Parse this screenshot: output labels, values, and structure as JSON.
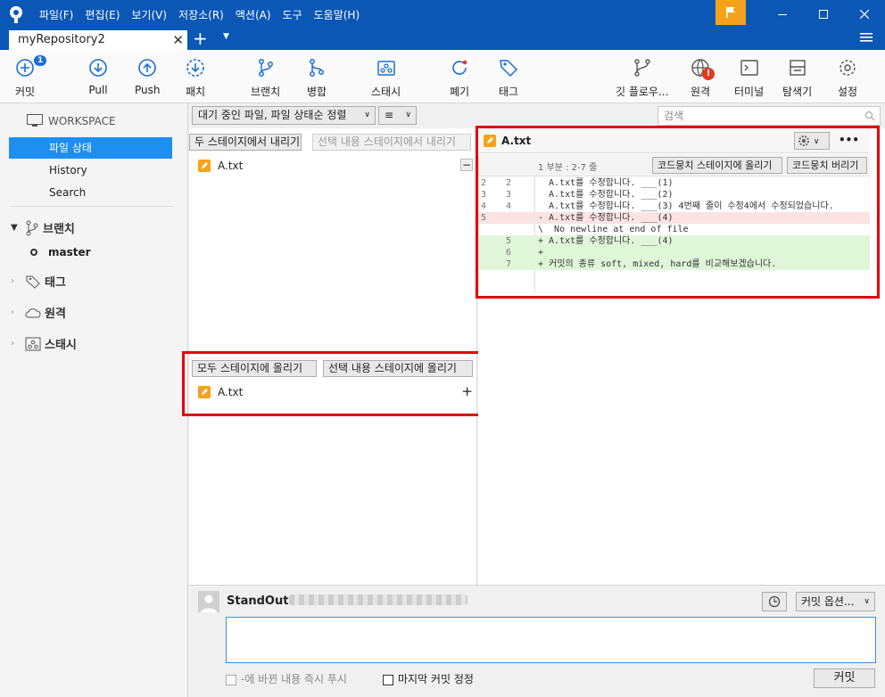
{
  "menu": [
    "파일(F)",
    "편집(E)",
    "보기(V)",
    "저장소(R)",
    "액션(A)",
    "도구",
    "도움말(H)"
  ],
  "tab": {
    "title": "myRepository2",
    "close": "✕",
    "new": "+"
  },
  "toolbar": {
    "commit": "커밋",
    "commit_badge": "1",
    "pull": "Pull",
    "push": "Push",
    "fetch": "패치",
    "branch": "브랜치",
    "merge": "병합",
    "stash": "스태시",
    "discard": "폐기",
    "tag": "태그",
    "gitflow": "깃 플로우...",
    "remote": "원격",
    "remote_badge": "!",
    "terminal": "터미널",
    "explorer": "탐색기",
    "settings": "설정"
  },
  "sidebar": {
    "workspace": "WORKSPACE",
    "items": [
      "파일 상태",
      "History",
      "Search"
    ],
    "branches": "브랜치",
    "master": "master",
    "tags": "태그",
    "remotes": "원격",
    "stashes": "스태시"
  },
  "filterbar": {
    "sort": "대기 중인 파일, 파일 상태순 정렬",
    "view": "≡",
    "search_placeholder": "검색"
  },
  "staged": {
    "unstage_all": "두 스테이지에서 내리기",
    "unstage_selected": "선택 내용 스테이지에서 내리기",
    "files": [
      {
        "name": "A.txt",
        "action": "−"
      }
    ]
  },
  "unstaged": {
    "stage_all": "모두 스테이지에 올리기",
    "stage_selected": "선택 내용 스테이지에 올리기",
    "files": [
      {
        "name": "A.txt",
        "action": "+"
      }
    ]
  },
  "diff": {
    "filename": "A.txt",
    "hunk": "1 부분 : 2-7 줄",
    "stage_hunk": "코드뭉치 스테이지에 올리기",
    "discard_hunk": "코드뭉치 버리기",
    "more": "•••",
    "lines": [
      {
        "old": "2",
        "new": "2",
        "text": "  A.txt를 수정합니다. ___(1)",
        "type": "ctx"
      },
      {
        "old": "3",
        "new": "3",
        "text": "  A.txt를 수정합니다. ___(2)",
        "type": "ctx"
      },
      {
        "old": "4",
        "new": "4",
        "text": "  A.txt를 수정합니다. ___(3) 4번째 줄이 수정4에서 수정되었습니다.",
        "type": "ctx"
      },
      {
        "old": "5",
        "new": "",
        "text": "- A.txt를 수정합니다. ___(4)",
        "type": "del"
      },
      {
        "old": "",
        "new": "",
        "text": "\\  No newline at end of file",
        "type": "ctx"
      },
      {
        "old": "",
        "new": "5",
        "text": "+ A.txt를 수정합니다. ___(4)",
        "type": "add"
      },
      {
        "old": "",
        "new": "6",
        "text": "+",
        "type": "add"
      },
      {
        "old": "",
        "new": "7",
        "text": "+ 커밋의 종류 soft, mixed, hard를 비교해보겠습니다.",
        "type": "add"
      }
    ]
  },
  "commit": {
    "author": "StandOut",
    "options": "커밋 옵션...",
    "push_now": "-에 바뀐 내용 즉시 푸시",
    "amend": "마지막 커밋 정정",
    "commit_btn": "커밋"
  }
}
